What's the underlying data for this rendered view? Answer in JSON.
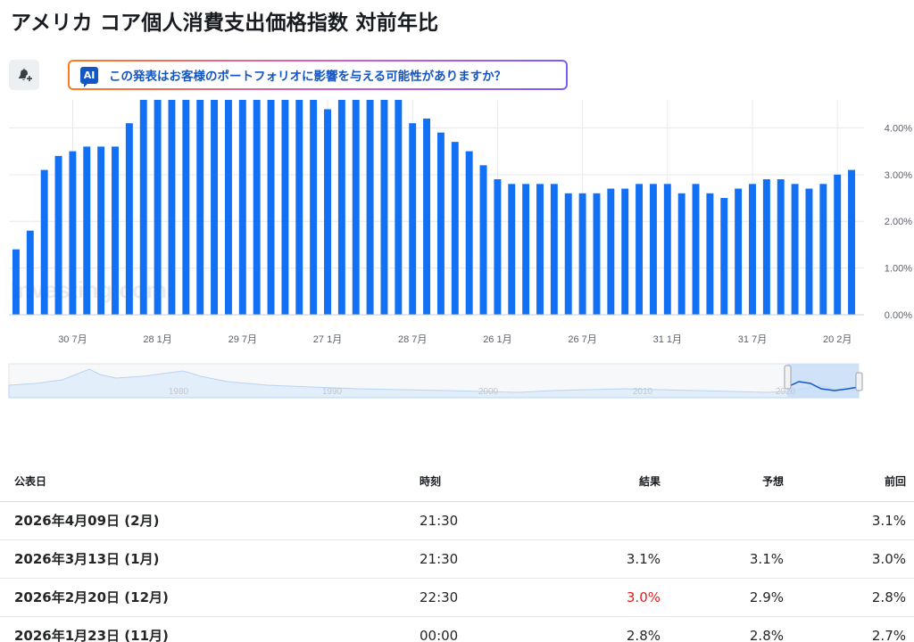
{
  "header": {
    "title": "アメリカ コア個人消費支出価格指数 対前年比"
  },
  "alert_button": {
    "icon": "bell-plus-icon"
  },
  "ai_banner": {
    "badge": "AI",
    "text": "この発表はお客様のポートフォリオに影響を与える可能性がありますか？"
  },
  "colors": {
    "bar": "#1170f4",
    "accent": "#1456c4",
    "negative": "#e11d1d",
    "grid": "#e6e9ec"
  },
  "chart_data": {
    "type": "bar",
    "y_unit": "%",
    "ylim": [
      0,
      4.6
    ],
    "y_ticks": [
      "4.00%",
      "3.00%",
      "2.00%",
      "1.00%",
      "0.00%"
    ],
    "x_tick_labels": [
      "30 7月",
      "28 1月",
      "29 7月",
      "27 1月",
      "28 7月",
      "26 1月",
      "26 7月",
      "31 1月",
      "31 7月",
      "20 2月"
    ],
    "values": [
      1.4,
      1.8,
      3.1,
      3.4,
      3.5,
      3.6,
      3.6,
      3.6,
      4.1,
      4.6,
      4.6,
      4.6,
      4.6,
      4.6,
      4.6,
      4.6,
      4.6,
      4.6,
      4.6,
      4.6,
      4.6,
      4.6,
      4.4,
      4.6,
      4.6,
      4.6,
      4.6,
      4.6,
      4.1,
      4.2,
      3.9,
      3.7,
      3.5,
      3.2,
      2.9,
      2.8,
      2.8,
      2.8,
      2.8,
      2.6,
      2.6,
      2.6,
      2.7,
      2.7,
      2.8,
      2.8,
      2.8,
      2.6,
      2.8,
      2.6,
      2.5,
      2.7,
      2.8,
      2.9,
      2.9,
      2.8,
      2.7,
      2.8,
      3.0,
      3.1
    ],
    "grid": true,
    "watermark": "Investing.com"
  },
  "navigator": {
    "year_labels": [
      "1980",
      "1990",
      "2000",
      "2010",
      "2020"
    ]
  },
  "table": {
    "headers": {
      "date": "公表日",
      "time": "時刻",
      "actual": "結果",
      "forecast": "予想",
      "previous": "前回"
    },
    "rows": [
      {
        "date": "2026年4月09日 (2月)",
        "time": "21:30",
        "actual": "",
        "forecast": "",
        "previous": "3.1%"
      },
      {
        "date": "2026年3月13日 (1月)",
        "time": "21:30",
        "actual": "3.1%",
        "forecast": "3.1%",
        "previous": "3.0%"
      },
      {
        "date": "2026年2月20日 (12月)",
        "time": "22:30",
        "actual": "3.0%",
        "forecast": "2.9%",
        "previous": "2.8%"
      },
      {
        "date": "2026年1月23日 (11月)",
        "time": "00:00",
        "actual": "2.8%",
        "forecast": "2.8%",
        "previous": "2.7%"
      }
    ]
  }
}
